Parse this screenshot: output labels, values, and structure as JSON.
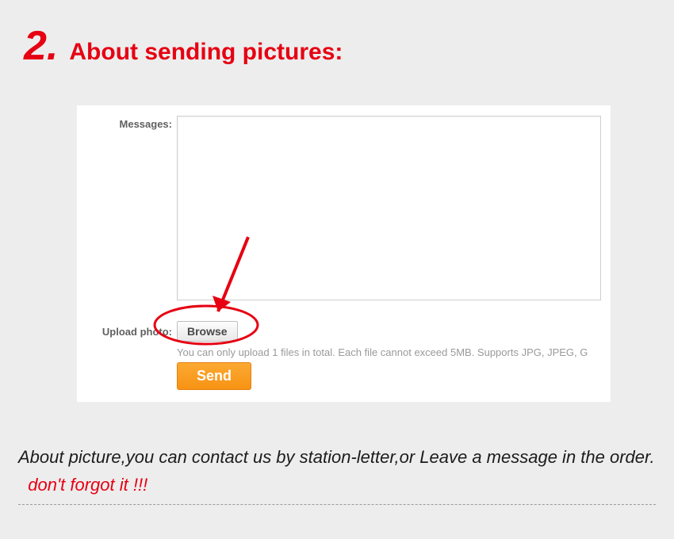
{
  "heading": {
    "number": "2.",
    "title": "About sending pictures:"
  },
  "form": {
    "messages_label": "Messages:",
    "messages_value": "",
    "upload_label": "Upload photo:",
    "browse_label": "Browse",
    "hint": "You can only upload 1 files in total. Each file cannot exceed 5MB. Supports JPG, JPEG, G",
    "send_label": "Send"
  },
  "footer": {
    "line": "About picture,you can contact us by station-letter,or Leave a message in the order.",
    "emphasis": "don't forgot it !!!"
  }
}
